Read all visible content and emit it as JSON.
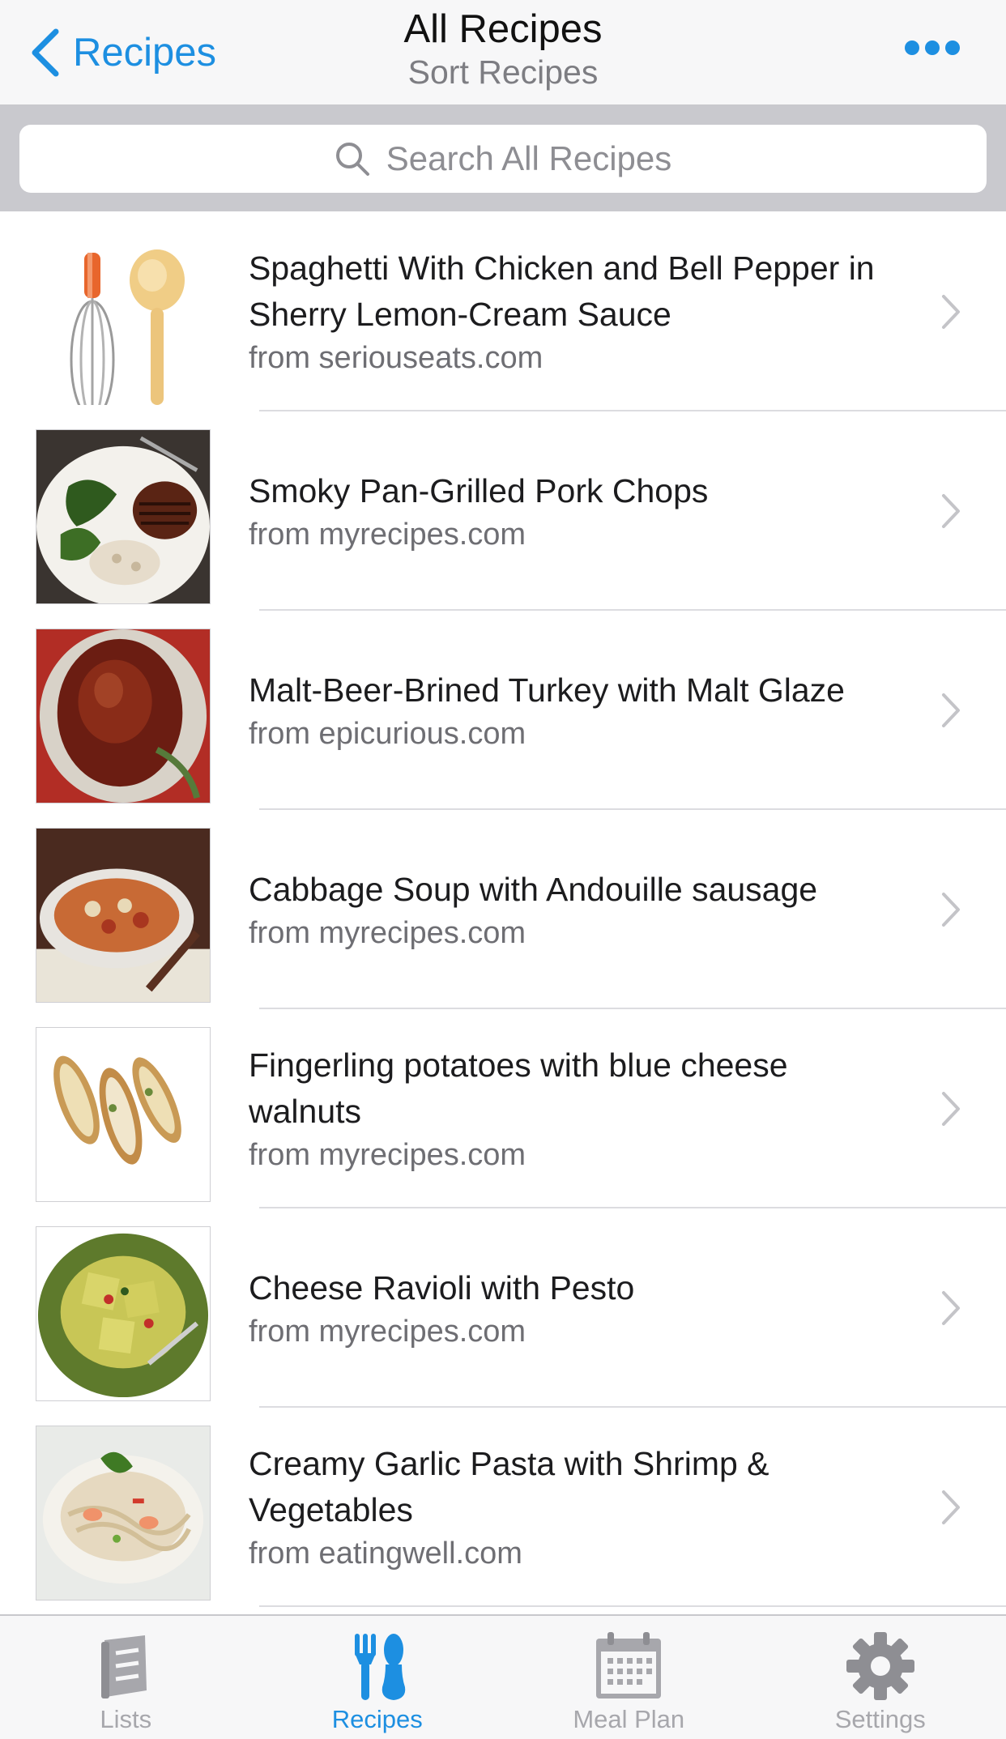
{
  "nav": {
    "back_label": "Recipes",
    "title": "All Recipes",
    "subtitle": "Sort Recipes"
  },
  "search": {
    "placeholder": "Search All Recipes"
  },
  "recipes": [
    {
      "title": "Spaghetti With Chicken and Bell Pepper in Sherry Lemon-Cream Sauce",
      "source": "from seriouseats.com"
    },
    {
      "title": "Smoky Pan-Grilled Pork Chops",
      "source": "from myrecipes.com"
    },
    {
      "title": "Malt-Beer-Brined Turkey with Malt Glaze",
      "source": "from epicurious.com"
    },
    {
      "title": "Cabbage Soup with Andouille sausage",
      "source": "from myrecipes.com"
    },
    {
      "title": "Fingerling potatoes with blue cheese walnuts",
      "source": "from myrecipes.com"
    },
    {
      "title": "Cheese Ravioli with Pesto",
      "source": "from myrecipes.com"
    },
    {
      "title": "Creamy Garlic Pasta with Shrimp & Vegetables",
      "source": "from eatingwell.com"
    }
  ],
  "tabs": [
    {
      "label": "Lists",
      "icon": "book-icon"
    },
    {
      "label": "Recipes",
      "icon": "fork-spoon-icon"
    },
    {
      "label": "Meal Plan",
      "icon": "calendar-icon"
    },
    {
      "label": "Settings",
      "icon": "gear-icon"
    }
  ],
  "active_tab": "Recipes",
  "colors": {
    "accent": "#1d8fe1",
    "inactive": "#a7a7ac",
    "nav_bg": "#f7f7f8",
    "search_bg": "#c9c9ce"
  }
}
